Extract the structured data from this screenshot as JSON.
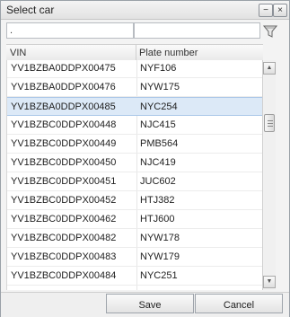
{
  "window": {
    "title": "Select car"
  },
  "titlebar_buttons": {
    "minimize_glyph": "−",
    "close_glyph": "×"
  },
  "filters": {
    "vin_value": ".",
    "plate_value": ""
  },
  "columns": {
    "vin": "VIN",
    "plate": "Plate number"
  },
  "rows": [
    {
      "vin": "YV1BZBA0DDPX00475",
      "plate": "NYF106"
    },
    {
      "vin": "YV1BZBA0DDPX00476",
      "plate": "NYW175"
    },
    {
      "vin": "YV1BZBA0DDPX00485",
      "plate": "NYC254",
      "selected": true
    },
    {
      "vin": "YV1BZBC0DDPX00448",
      "plate": "NJC415"
    },
    {
      "vin": "YV1BZBC0DDPX00449",
      "plate": "PMB564"
    },
    {
      "vin": "YV1BZBC0DDPX00450",
      "plate": "NJC419"
    },
    {
      "vin": "YV1BZBC0DDPX00451",
      "plate": "JUC602"
    },
    {
      "vin": "YV1BZBC0DDPX00452",
      "plate": "HTJ382"
    },
    {
      "vin": "YV1BZBC0DDPX00462",
      "plate": "HTJ600"
    },
    {
      "vin": "YV1BZBC0DDPX00482",
      "plate": "NYW178"
    },
    {
      "vin": "YV1BZBC0DDPX00483",
      "plate": "NYW179"
    },
    {
      "vin": "YV1BZBC0DDPX00484",
      "plate": "NYC251"
    }
  ],
  "scrollbar": {
    "up_glyph": "▲",
    "down_glyph": "▼"
  },
  "buttons": {
    "save": "Save",
    "cancel": "Cancel"
  },
  "colors": {
    "selected_row": "#dce9f7",
    "selected_border": "#aac7e8"
  }
}
